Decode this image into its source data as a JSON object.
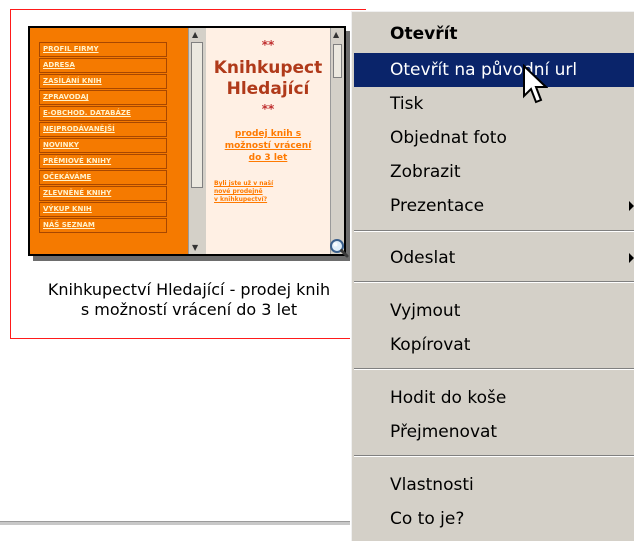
{
  "thumbnail": {
    "nav_items": [
      "PROFIL FIRMY",
      "ADRESA",
      "ZASÍLÁNÍ KNIH",
      "ZPRAVODAJ",
      "E-OBCHOD. DATABÁZE",
      "NEJPRODÁVANĚJŠÍ",
      "NOVINKY",
      "PRÉMIOVÉ KNIHY",
      "OČEKÁVÁME",
      "ZLEVNĚNÉ KNIHY",
      "VÝKUP KNIH",
      "NÁŠ SEZNAM"
    ],
    "stars": "**",
    "title_line1": "Knihkupect",
    "title_line2": "Hledající",
    "sub_line1": "prodej knih s",
    "sub_line2": "možností vrácení",
    "sub_line3": "do 3 let",
    "small_line1": "Byli jste už v naší",
    "small_line2": "nové prodejně",
    "small_line3": "v knihkupectví?"
  },
  "caption": {
    "line1": "Knihkupectví Hledající - prodej knih",
    "line2": "s možností vrácení do 3 let"
  },
  "context_menu": {
    "items": [
      {
        "label": "Otevřít"
      },
      {
        "label": "Otevřít na původní url"
      },
      {
        "label": "Tisk"
      },
      {
        "label": "Objednat foto"
      },
      {
        "label": "Zobrazit"
      },
      {
        "label": "Prezentace"
      },
      {
        "label": "Odeslat"
      },
      {
        "label": "Vyjmout"
      },
      {
        "label": "Kopírovat"
      },
      {
        "label": "Hodit do koše"
      },
      {
        "label": "Přejmenovat"
      },
      {
        "label": "Vlastnosti"
      },
      {
        "label": "Co to je?"
      }
    ],
    "highlight_color": "#0a246a"
  }
}
